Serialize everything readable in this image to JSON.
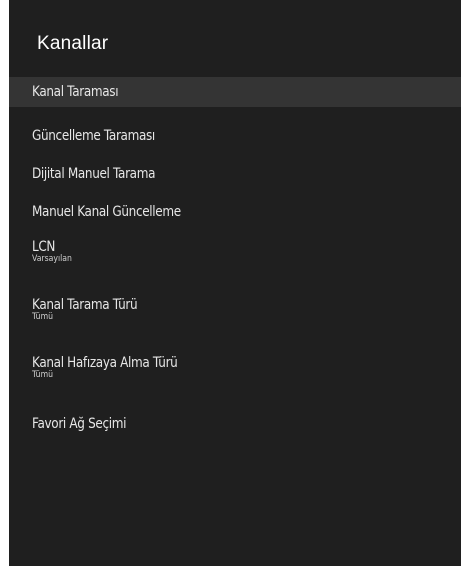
{
  "panel": {
    "title": "Kanallar"
  },
  "menu": {
    "items": [
      {
        "label": "Kanal Taraması",
        "selected": true
      },
      {
        "label": "Güncelleme Taraması"
      },
      {
        "label": "Dijital Manuel Tarama"
      },
      {
        "label": "Manuel Kanal Güncelleme"
      },
      {
        "label": "LCN",
        "value": "Varsayılan"
      },
      {
        "label": "Kanal Tarama Türü",
        "value": "Tümü"
      },
      {
        "label": "Kanal Hafızaya Alma Türü",
        "value": "Tümü"
      },
      {
        "label": "Favori Ağ Seçimi"
      }
    ]
  },
  "colors": {
    "panel_bg": "#1f1f1f",
    "selected_bg": "#343434",
    "text": "#e6e6e6"
  }
}
